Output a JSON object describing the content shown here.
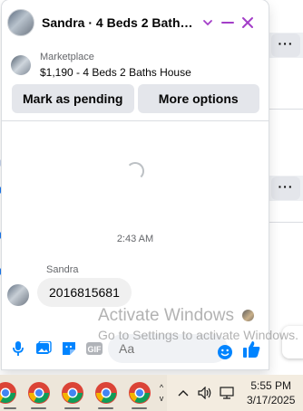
{
  "chat": {
    "header": {
      "title": "Sandra · 4 Beds 2 Baths H···"
    },
    "listing": {
      "label": "Marketplace",
      "title": "$1,190 - 4 Beds 2 Baths House"
    },
    "actions": {
      "mark_pending": "Mark as pending",
      "more_options": "More options"
    },
    "messages": {
      "timestamp": "2:43 AM",
      "sender": "Sandra",
      "text": "2016815681"
    },
    "composer": {
      "placeholder": "Aa"
    }
  },
  "background": {
    "more_label": "···"
  },
  "watermark": {
    "title": "Activate Windows",
    "subtitle": "Go to Settings to activate Windows."
  },
  "taskbar": {
    "time": "5:55 PM",
    "date": "3/17/2025",
    "scroll_up": "^",
    "scroll_down": "v"
  },
  "colors": {
    "accent": "#a33ec8",
    "messenger_blue": "#0084ff",
    "button_gray": "#e4e6eb",
    "bubble_gray": "#f0f0f0",
    "taskbar": "#f3ece0"
  }
}
